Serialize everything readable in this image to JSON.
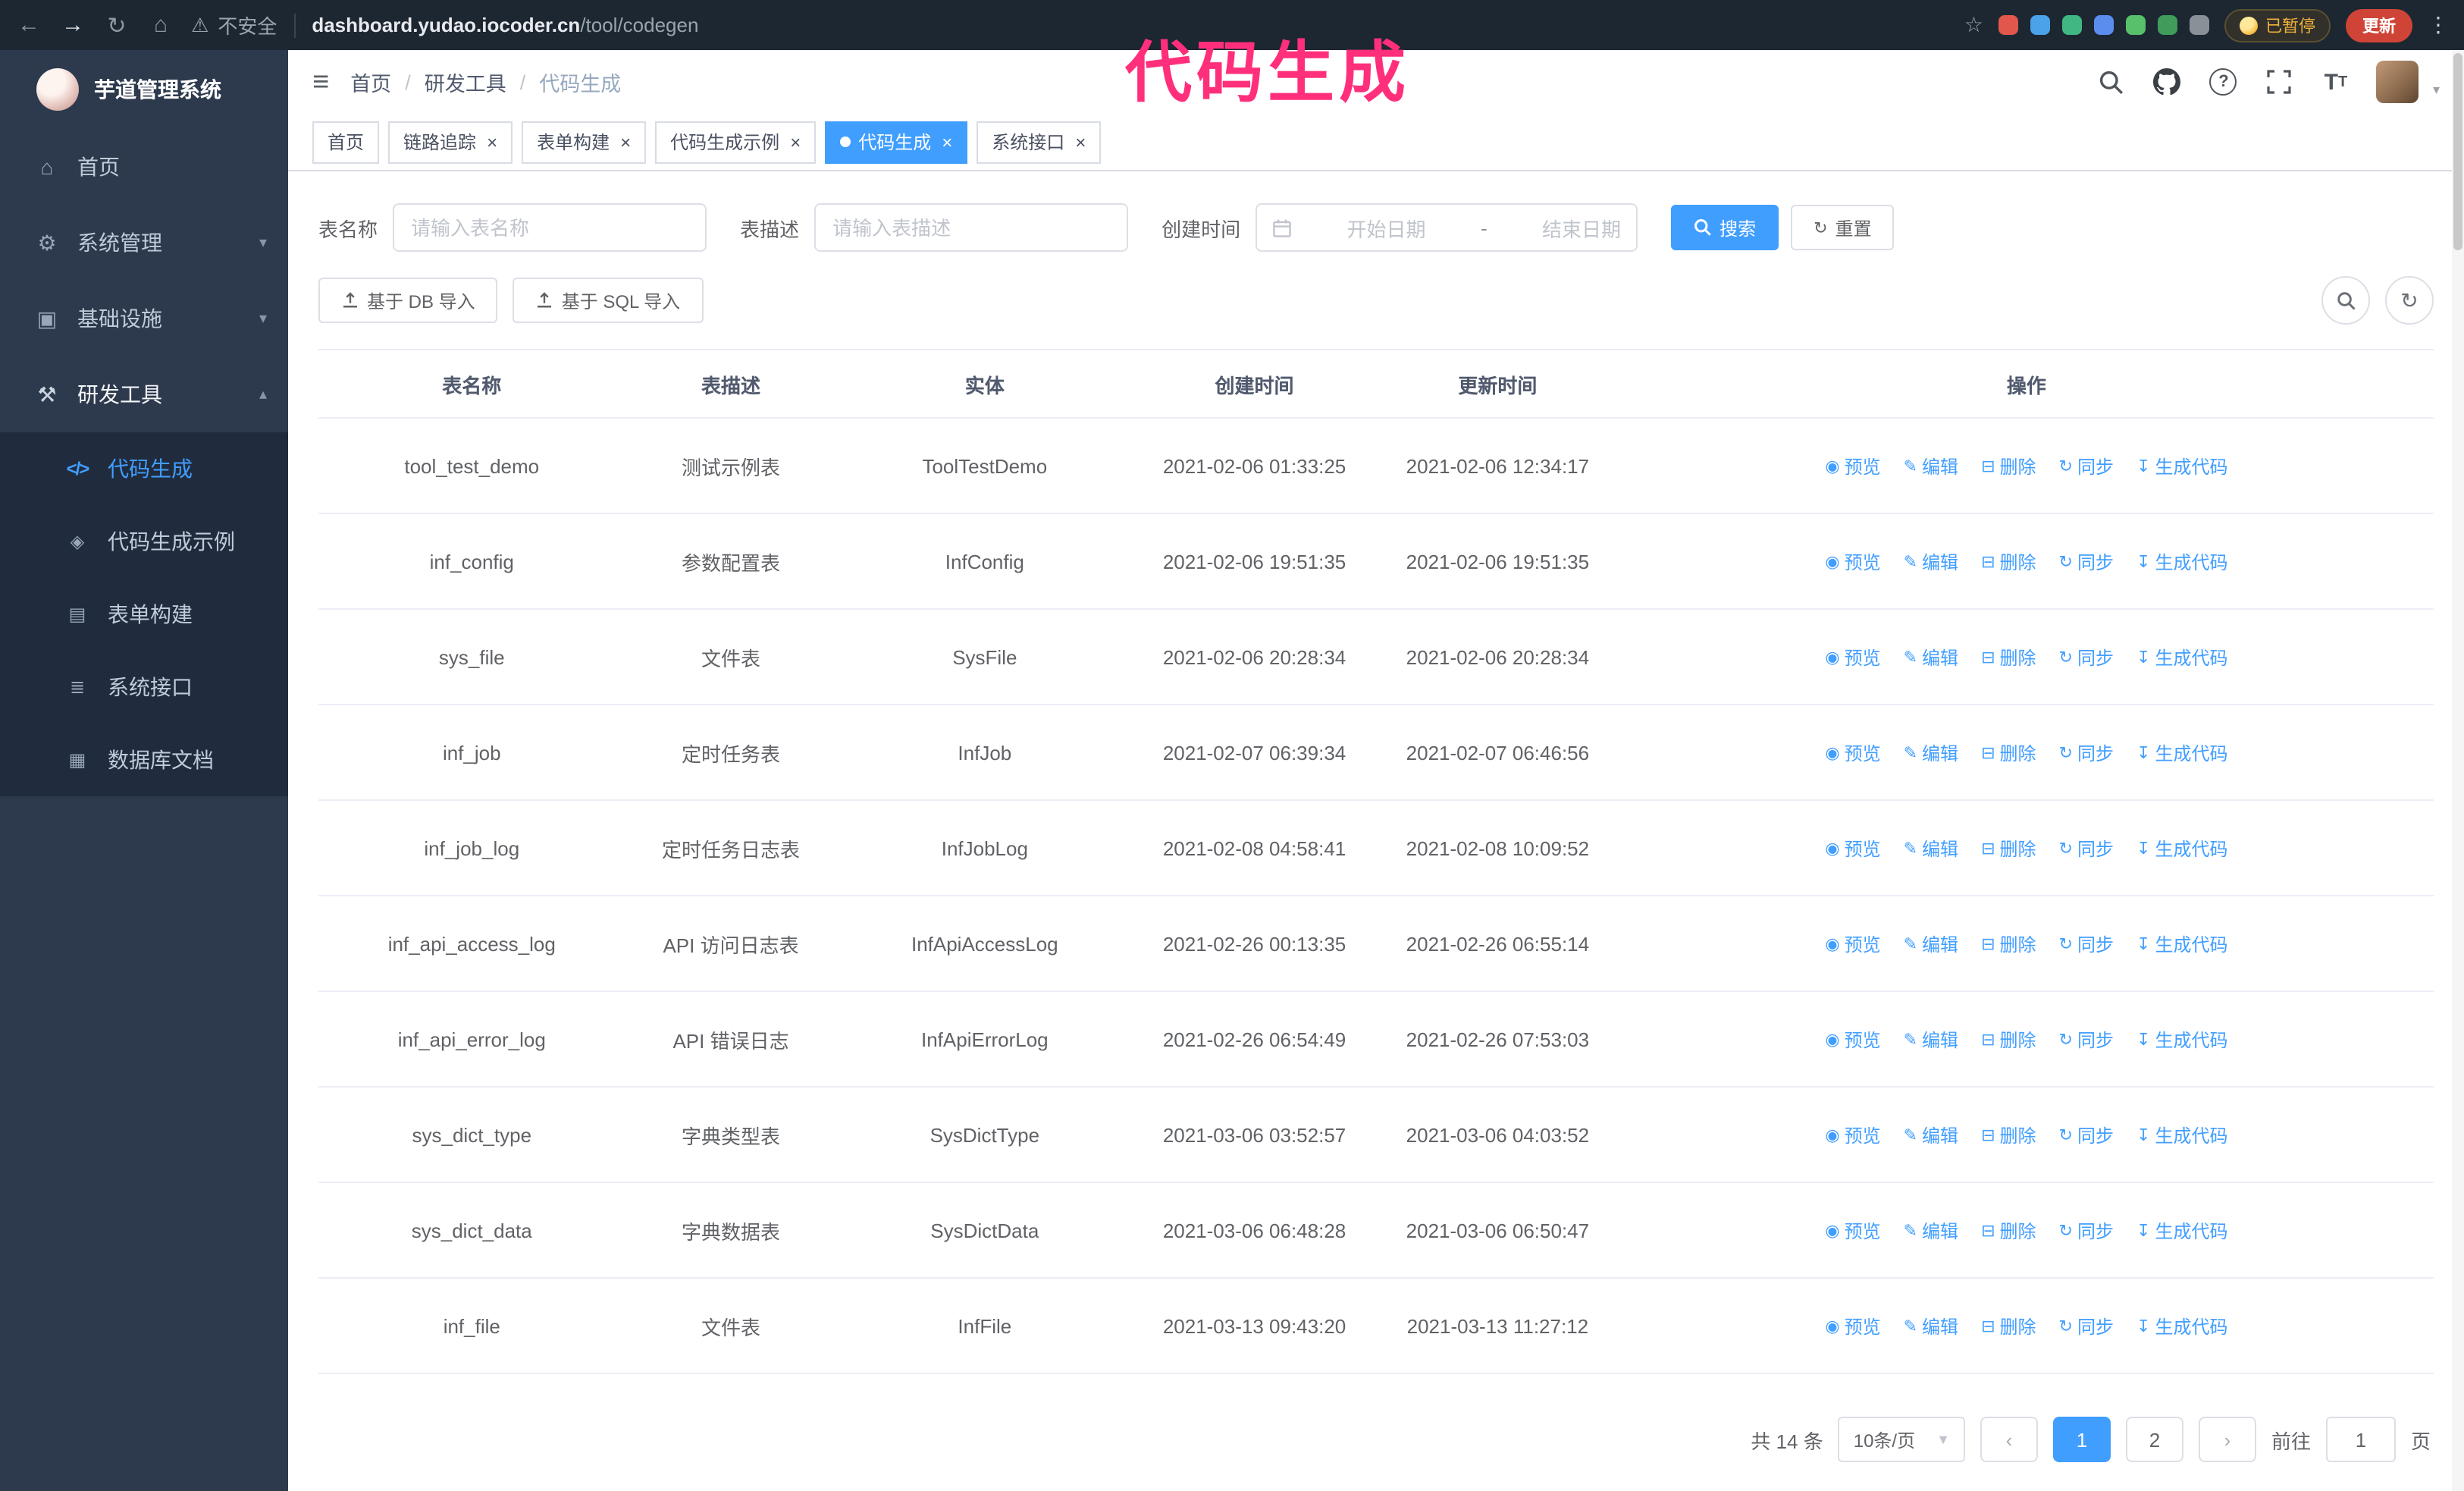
{
  "colors": {
    "primary": "#409eff",
    "sidebar_bg": "#2d3a4d",
    "chrome_bg": "#1c2732",
    "active_tab_bg": "#409eff"
  },
  "annotation": {
    "text": "代码生成",
    "color": "#ff2f7b"
  },
  "browser": {
    "security_warning": "不安全",
    "url_host": "dashboard.yudao.iocoder.cn",
    "url_path": "/tool/codegen",
    "paused_badge": "已暂停",
    "update_button": "更新",
    "extensions": [
      {
        "name": "extension-paw",
        "color": "#e2574c"
      },
      {
        "name": "extension-drop",
        "color": "#4aa3e8"
      },
      {
        "name": "extension-vue",
        "color": "#41b883"
      },
      {
        "name": "extension-users",
        "color": "#5b8def"
      },
      {
        "name": "extension-battery",
        "color": "#58c06a"
      },
      {
        "name": "extension-leaf",
        "color": "#3f9c5a"
      },
      {
        "name": "extension-puzzle",
        "color": "#8a9097"
      }
    ]
  },
  "sidebar": {
    "title": "芋道管理系统",
    "items": [
      {
        "id": "home",
        "label": "首页",
        "icon": "home-icon"
      },
      {
        "id": "system",
        "label": "系统管理",
        "icon": "gear-icon",
        "expandable": true
      },
      {
        "id": "infra",
        "label": "基础设施",
        "icon": "infra-icon",
        "expandable": true
      },
      {
        "id": "devtools",
        "label": "研发工具",
        "icon": "tools-icon",
        "expandable": true,
        "expanded": true,
        "children": [
          {
            "id": "codegen",
            "label": "代码生成",
            "icon": "code-icon",
            "active": true
          },
          {
            "id": "codegen-example",
            "label": "代码生成示例",
            "icon": "example-icon"
          },
          {
            "id": "form-build",
            "label": "表单构建",
            "icon": "form-icon"
          },
          {
            "id": "api",
            "label": "系统接口",
            "icon": "api-icon"
          },
          {
            "id": "db-doc",
            "label": "数据库文档",
            "icon": "dbdoc-icon"
          }
        ]
      }
    ]
  },
  "header": {
    "breadcrumb": [
      "首页",
      "研发工具",
      "代码生成"
    ]
  },
  "tabs": [
    {
      "label": "首页",
      "closable": false,
      "active": false
    },
    {
      "label": "链路追踪",
      "closable": true,
      "active": false
    },
    {
      "label": "表单构建",
      "closable": true,
      "active": false
    },
    {
      "label": "代码生成示例",
      "closable": true,
      "active": false
    },
    {
      "label": "代码生成",
      "closable": true,
      "active": true
    },
    {
      "label": "系统接口",
      "closable": true,
      "active": false
    }
  ],
  "filters": {
    "name_label": "表名称",
    "name_placeholder": "请输入表名称",
    "desc_label": "表描述",
    "desc_placeholder": "请输入表描述",
    "time_label": "创建时间",
    "start_placeholder": "开始日期",
    "separator": "-",
    "end_placeholder": "结束日期",
    "search_label": "搜索",
    "reset_label": "重置"
  },
  "toolbar": {
    "import_db": "基于 DB 导入",
    "import_sql": "基于 SQL 导入"
  },
  "table": {
    "columns": [
      "表名称",
      "表描述",
      "实体",
      "创建时间",
      "更新时间",
      "操作"
    ],
    "ops": [
      "预览",
      "编辑",
      "删除",
      "同步",
      "生成代码"
    ],
    "rows": [
      {
        "name": "tool_test_demo",
        "desc": "测试示例表",
        "entity": "ToolTestDemo",
        "created": "2021-02-06 01:33:25",
        "updated": "2021-02-06 12:34:17"
      },
      {
        "name": "inf_config",
        "desc": "参数配置表",
        "entity": "InfConfig",
        "created": "2021-02-06 19:51:35",
        "updated": "2021-02-06 19:51:35"
      },
      {
        "name": "sys_file",
        "desc": "文件表",
        "entity": "SysFile",
        "created": "2021-02-06 20:28:34",
        "updated": "2021-02-06 20:28:34"
      },
      {
        "name": "inf_job",
        "desc": "定时任务表",
        "entity": "InfJob",
        "created": "2021-02-07 06:39:34",
        "updated": "2021-02-07 06:46:56"
      },
      {
        "name": "inf_job_log",
        "desc": "定时任务日志表",
        "entity": "InfJobLog",
        "created": "2021-02-08 04:58:41",
        "updated": "2021-02-08 10:09:52"
      },
      {
        "name": "inf_api_access_log",
        "desc": "API 访问日志表",
        "entity": "InfApiAccessLog",
        "created": "2021-02-26 00:13:35",
        "updated": "2021-02-26 06:55:14"
      },
      {
        "name": "inf_api_error_log",
        "desc": "API 错误日志",
        "entity": "InfApiErrorLog",
        "created": "2021-02-26 06:54:49",
        "updated": "2021-02-26 07:53:03"
      },
      {
        "name": "sys_dict_type",
        "desc": "字典类型表",
        "entity": "SysDictType",
        "created": "2021-03-06 03:52:57",
        "updated": "2021-03-06 04:03:52"
      },
      {
        "name": "sys_dict_data",
        "desc": "字典数据表",
        "entity": "SysDictData",
        "created": "2021-03-06 06:48:28",
        "updated": "2021-03-06 06:50:47"
      },
      {
        "name": "inf_file",
        "desc": "文件表",
        "entity": "InfFile",
        "created": "2021-03-13 09:43:20",
        "updated": "2021-03-13 11:27:12"
      }
    ]
  },
  "pagination": {
    "total": "共 14 条",
    "page_size": "10条/页",
    "pages": [
      "1",
      "2"
    ],
    "active": "1",
    "goto": "前往",
    "goto_value": "1",
    "suffix": "页"
  }
}
